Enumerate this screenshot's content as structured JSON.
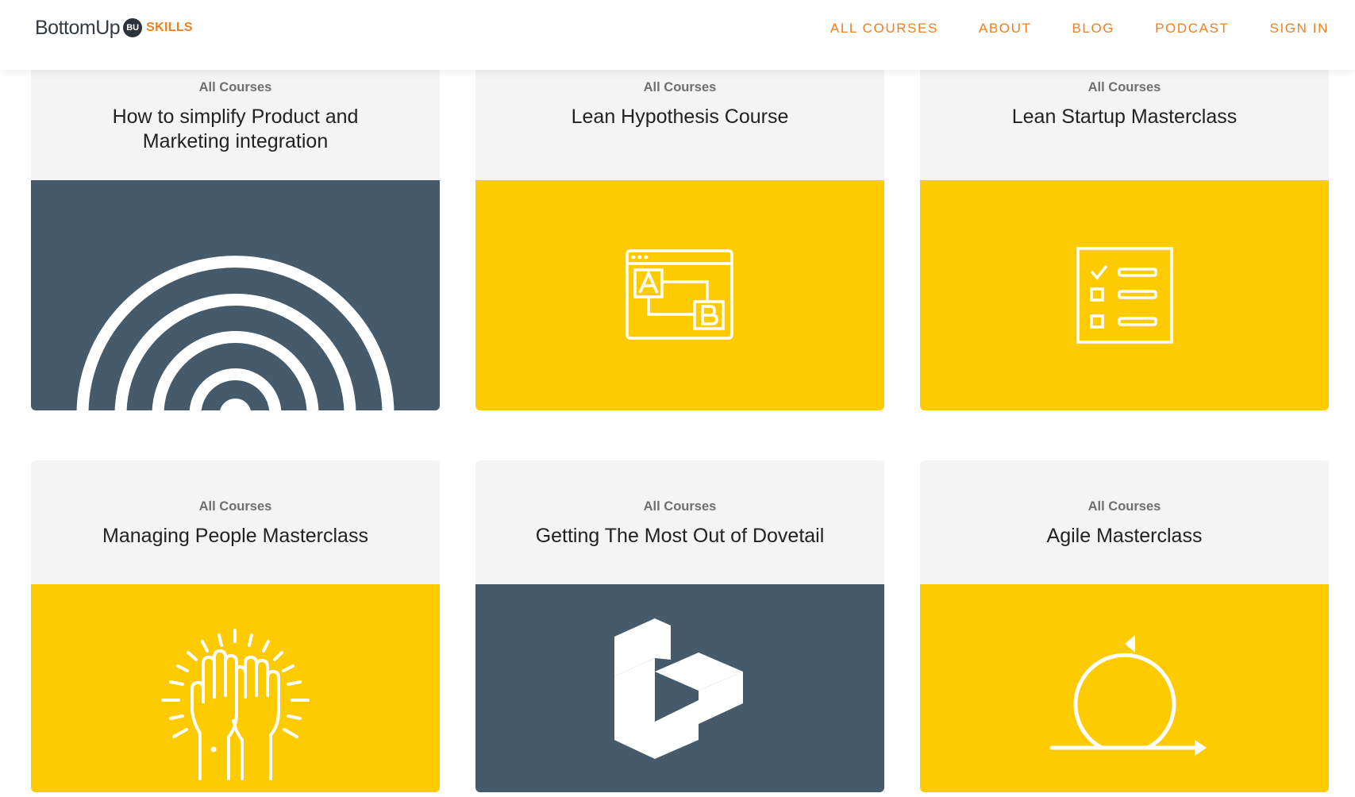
{
  "header": {
    "logo": {
      "text": "BottomUp",
      "badge": "BU",
      "suffix": "SKILLS"
    },
    "nav": [
      {
        "label": "ALL COURSES"
      },
      {
        "label": "ABOUT"
      },
      {
        "label": "BLOG"
      },
      {
        "label": "PODCAST"
      },
      {
        "label": "SIGN IN"
      }
    ]
  },
  "colors": {
    "accent": "#f07f1e",
    "yellow": "#fecb00",
    "slate": "#455a6b",
    "card_bg": "#f4f4f4"
  },
  "cards": [
    {
      "category": "All Courses",
      "title": "How to simplify Product and Marketing integration",
      "icon": "concentric-arcs-icon",
      "bg": "slate"
    },
    {
      "category": "All Courses",
      "title": "Lean Hypothesis Course",
      "icon": "ab-test-icon",
      "bg": "yellow"
    },
    {
      "category": "All Courses",
      "title": "Lean Startup Masterclass",
      "icon": "checklist-icon",
      "bg": "yellow"
    },
    {
      "category": "All Courses",
      "title": "Managing People Masterclass",
      "icon": "high-five-icon",
      "bg": "yellow"
    },
    {
      "category": "All Courses",
      "title": "Getting The Most Out of Dovetail",
      "icon": "dovetail-logo-icon",
      "bg": "slate"
    },
    {
      "category": "All Courses",
      "title": "Agile Masterclass",
      "icon": "agile-loop-icon",
      "bg": "yellow"
    }
  ]
}
